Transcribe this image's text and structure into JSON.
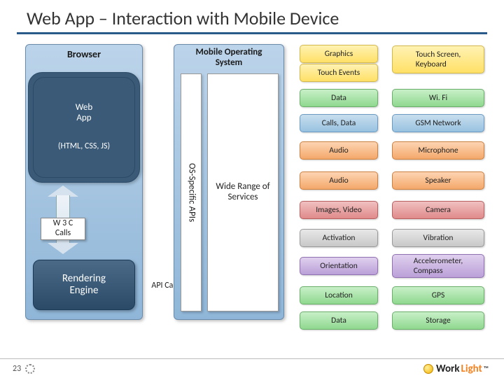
{
  "title": "Web App – Interaction with Mobile Device",
  "browser": {
    "label": "Browser",
    "webapp": "Web\nApp",
    "webapp_sub": "(HTML, CSS, JS)",
    "w3c": "W 3 C\nCalls",
    "render": "Rendering\nEngine",
    "api_calls": "API Calls"
  },
  "mos": {
    "label": "Mobile  Operating\nSystem",
    "os_api": "OS-Specific APIs",
    "services": "Wide Range of\nServices"
  },
  "mid": [
    {
      "label": "Graphics",
      "cls": "yellow"
    },
    {
      "label": "Touch Events",
      "cls": "yellow"
    },
    {
      "label": "Data",
      "cls": "green"
    },
    {
      "label": "Calls, Data",
      "cls": "blue"
    },
    {
      "label": "Audio",
      "cls": "orange"
    },
    {
      "label": "Audio",
      "cls": "orange"
    },
    {
      "label": "Images, Video",
      "cls": "red"
    },
    {
      "label": "Activation",
      "cls": "grey"
    },
    {
      "label": "Orientation",
      "cls": "purple"
    },
    {
      "label": "Location",
      "cls": "green"
    },
    {
      "label": "Data",
      "cls": "green"
    }
  ],
  "right": [
    {
      "label": "Touch Screen,\nKeyboard",
      "cls": "yellow"
    },
    {
      "label": "Wi. Fi",
      "cls": "green"
    },
    {
      "label": "GSM Network",
      "cls": "blue"
    },
    {
      "label": "Microphone",
      "cls": "orange"
    },
    {
      "label": "Speaker",
      "cls": "orange"
    },
    {
      "label": "Camera",
      "cls": "red"
    },
    {
      "label": "Vibration",
      "cls": "grey"
    },
    {
      "label": "Accelerometer,\nCompass",
      "cls": "purple"
    },
    {
      "label": "GPS",
      "cls": "green"
    },
    {
      "label": "Storage",
      "cls": "green"
    }
  ],
  "footer": {
    "page": "23",
    "logo_w": "Work",
    "logo_l": "Light"
  }
}
